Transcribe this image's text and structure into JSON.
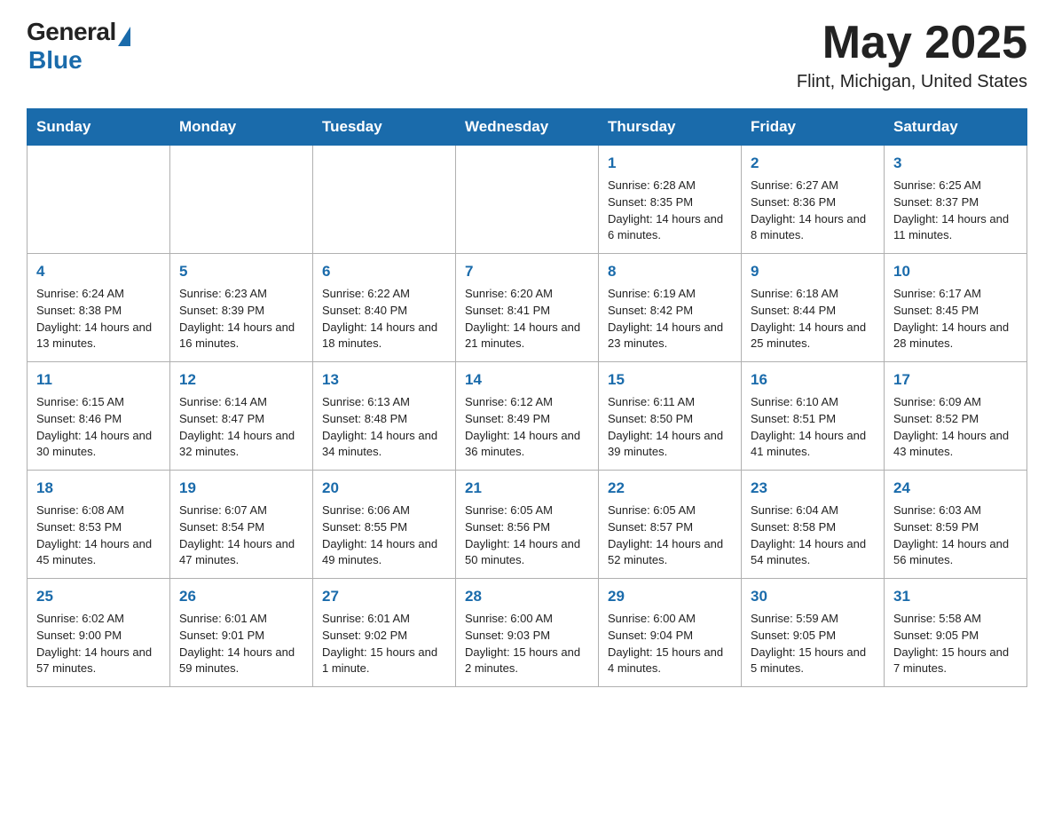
{
  "header": {
    "logo_general": "General",
    "logo_blue": "Blue",
    "month_year": "May 2025",
    "location": "Flint, Michigan, United States"
  },
  "days_of_week": [
    "Sunday",
    "Monday",
    "Tuesday",
    "Wednesday",
    "Thursday",
    "Friday",
    "Saturday"
  ],
  "weeks": [
    [
      {
        "day": "",
        "info": ""
      },
      {
        "day": "",
        "info": ""
      },
      {
        "day": "",
        "info": ""
      },
      {
        "day": "",
        "info": ""
      },
      {
        "day": "1",
        "info": "Sunrise: 6:28 AM\nSunset: 8:35 PM\nDaylight: 14 hours and 6 minutes."
      },
      {
        "day": "2",
        "info": "Sunrise: 6:27 AM\nSunset: 8:36 PM\nDaylight: 14 hours and 8 minutes."
      },
      {
        "day": "3",
        "info": "Sunrise: 6:25 AM\nSunset: 8:37 PM\nDaylight: 14 hours and 11 minutes."
      }
    ],
    [
      {
        "day": "4",
        "info": "Sunrise: 6:24 AM\nSunset: 8:38 PM\nDaylight: 14 hours and 13 minutes."
      },
      {
        "day": "5",
        "info": "Sunrise: 6:23 AM\nSunset: 8:39 PM\nDaylight: 14 hours and 16 minutes."
      },
      {
        "day": "6",
        "info": "Sunrise: 6:22 AM\nSunset: 8:40 PM\nDaylight: 14 hours and 18 minutes."
      },
      {
        "day": "7",
        "info": "Sunrise: 6:20 AM\nSunset: 8:41 PM\nDaylight: 14 hours and 21 minutes."
      },
      {
        "day": "8",
        "info": "Sunrise: 6:19 AM\nSunset: 8:42 PM\nDaylight: 14 hours and 23 minutes."
      },
      {
        "day": "9",
        "info": "Sunrise: 6:18 AM\nSunset: 8:44 PM\nDaylight: 14 hours and 25 minutes."
      },
      {
        "day": "10",
        "info": "Sunrise: 6:17 AM\nSunset: 8:45 PM\nDaylight: 14 hours and 28 minutes."
      }
    ],
    [
      {
        "day": "11",
        "info": "Sunrise: 6:15 AM\nSunset: 8:46 PM\nDaylight: 14 hours and 30 minutes."
      },
      {
        "day": "12",
        "info": "Sunrise: 6:14 AM\nSunset: 8:47 PM\nDaylight: 14 hours and 32 minutes."
      },
      {
        "day": "13",
        "info": "Sunrise: 6:13 AM\nSunset: 8:48 PM\nDaylight: 14 hours and 34 minutes."
      },
      {
        "day": "14",
        "info": "Sunrise: 6:12 AM\nSunset: 8:49 PM\nDaylight: 14 hours and 36 minutes."
      },
      {
        "day": "15",
        "info": "Sunrise: 6:11 AM\nSunset: 8:50 PM\nDaylight: 14 hours and 39 minutes."
      },
      {
        "day": "16",
        "info": "Sunrise: 6:10 AM\nSunset: 8:51 PM\nDaylight: 14 hours and 41 minutes."
      },
      {
        "day": "17",
        "info": "Sunrise: 6:09 AM\nSunset: 8:52 PM\nDaylight: 14 hours and 43 minutes."
      }
    ],
    [
      {
        "day": "18",
        "info": "Sunrise: 6:08 AM\nSunset: 8:53 PM\nDaylight: 14 hours and 45 minutes."
      },
      {
        "day": "19",
        "info": "Sunrise: 6:07 AM\nSunset: 8:54 PM\nDaylight: 14 hours and 47 minutes."
      },
      {
        "day": "20",
        "info": "Sunrise: 6:06 AM\nSunset: 8:55 PM\nDaylight: 14 hours and 49 minutes."
      },
      {
        "day": "21",
        "info": "Sunrise: 6:05 AM\nSunset: 8:56 PM\nDaylight: 14 hours and 50 minutes."
      },
      {
        "day": "22",
        "info": "Sunrise: 6:05 AM\nSunset: 8:57 PM\nDaylight: 14 hours and 52 minutes."
      },
      {
        "day": "23",
        "info": "Sunrise: 6:04 AM\nSunset: 8:58 PM\nDaylight: 14 hours and 54 minutes."
      },
      {
        "day": "24",
        "info": "Sunrise: 6:03 AM\nSunset: 8:59 PM\nDaylight: 14 hours and 56 minutes."
      }
    ],
    [
      {
        "day": "25",
        "info": "Sunrise: 6:02 AM\nSunset: 9:00 PM\nDaylight: 14 hours and 57 minutes."
      },
      {
        "day": "26",
        "info": "Sunrise: 6:01 AM\nSunset: 9:01 PM\nDaylight: 14 hours and 59 minutes."
      },
      {
        "day": "27",
        "info": "Sunrise: 6:01 AM\nSunset: 9:02 PM\nDaylight: 15 hours and 1 minute."
      },
      {
        "day": "28",
        "info": "Sunrise: 6:00 AM\nSunset: 9:03 PM\nDaylight: 15 hours and 2 minutes."
      },
      {
        "day": "29",
        "info": "Sunrise: 6:00 AM\nSunset: 9:04 PM\nDaylight: 15 hours and 4 minutes."
      },
      {
        "day": "30",
        "info": "Sunrise: 5:59 AM\nSunset: 9:05 PM\nDaylight: 15 hours and 5 minutes."
      },
      {
        "day": "31",
        "info": "Sunrise: 5:58 AM\nSunset: 9:05 PM\nDaylight: 15 hours and 7 minutes."
      }
    ]
  ]
}
